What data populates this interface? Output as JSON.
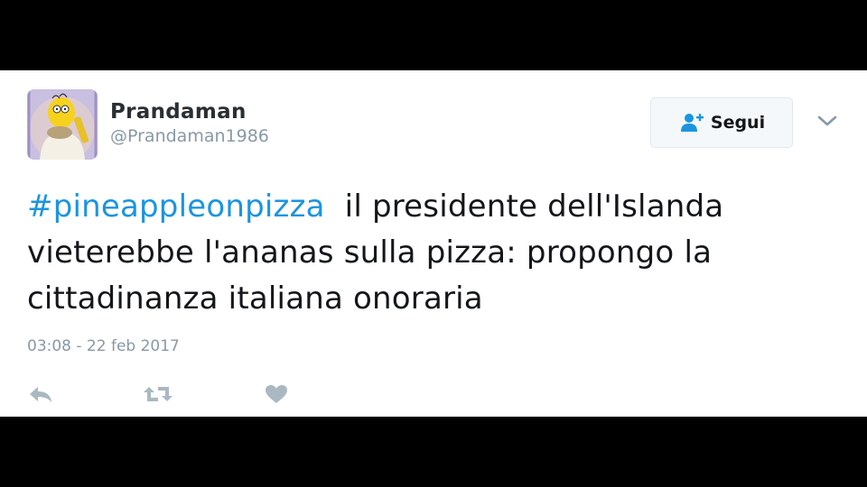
{
  "user": {
    "display_name": "Prandaman",
    "handle": "@Prandaman1986",
    "avatar_icon": "cartoon-avatar-icon"
  },
  "follow_button": {
    "label": "Segui",
    "icon": "add-user-icon"
  },
  "menu_icon": "chevron-down-icon",
  "tweet": {
    "hashtag": "#pineappleonpizza",
    "text": "  il presidente dell'Islanda vieterebbe l'ananas sulla pizza: propongo la cittadinanza italiana onoraria",
    "timestamp": "03:08 - 22 feb 2017"
  },
  "actions": [
    {
      "name": "reply",
      "icon": "reply-icon"
    },
    {
      "name": "retweet",
      "icon": "retweet-icon"
    },
    {
      "name": "like",
      "icon": "heart-icon"
    }
  ],
  "colors": {
    "hashtag": "#1b95e0",
    "follow_icon": "#1b95e0",
    "muted": "#8899a6",
    "action_icons": "#aab8c2",
    "text": "#14171a",
    "letterbox": "#000000"
  }
}
